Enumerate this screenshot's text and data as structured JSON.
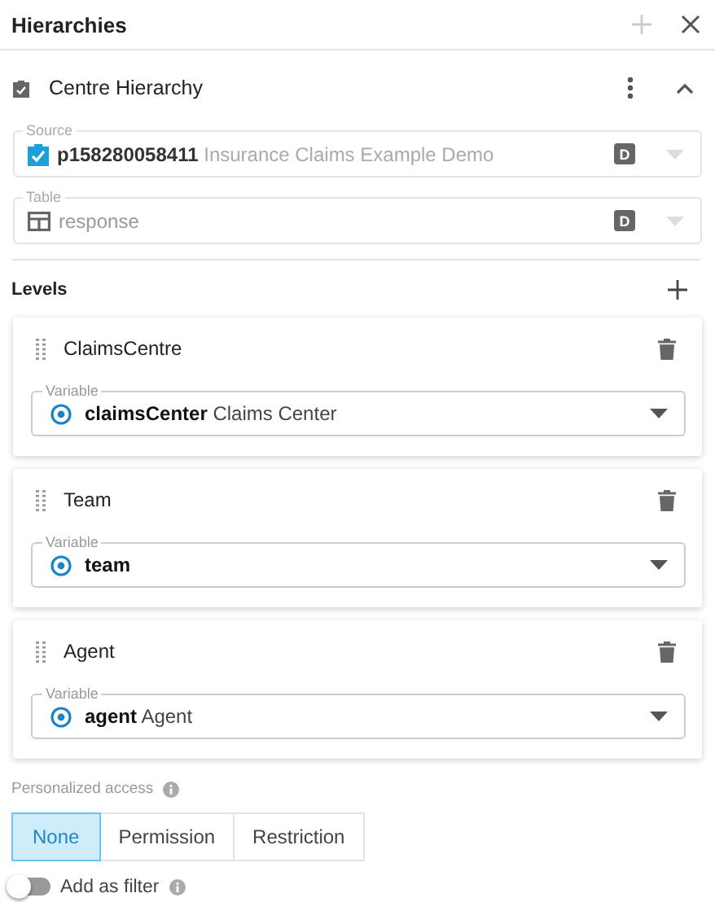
{
  "header": {
    "title": "Hierarchies"
  },
  "hierarchy": {
    "title": "Centre Hierarchy",
    "expanded": true
  },
  "source": {
    "label": "Source",
    "id": "p158280058411",
    "name": "Insurance Claims Example Demo",
    "badge": "D",
    "disabled": true
  },
  "table": {
    "label": "Table",
    "value": "response",
    "badge": "D",
    "disabled": true
  },
  "levels": {
    "title": "Levels",
    "items": [
      {
        "name": "ClaimsCentre",
        "variable_label": "Variable",
        "variable": "claimsCenter",
        "variable_text": "Claims Center"
      },
      {
        "name": "Team",
        "variable_label": "Variable",
        "variable": "team"
      },
      {
        "name": "Agent",
        "variable_label": "Variable",
        "variable": "agent",
        "variable_text": "Agent"
      }
    ]
  },
  "personalized_access": {
    "label": "Personalized access",
    "options": [
      {
        "label": "None",
        "selected": true
      },
      {
        "label": "Permission",
        "selected": false
      },
      {
        "label": "Restriction",
        "selected": false
      }
    ]
  },
  "filter": {
    "label": "Add as filter",
    "on": false
  }
}
